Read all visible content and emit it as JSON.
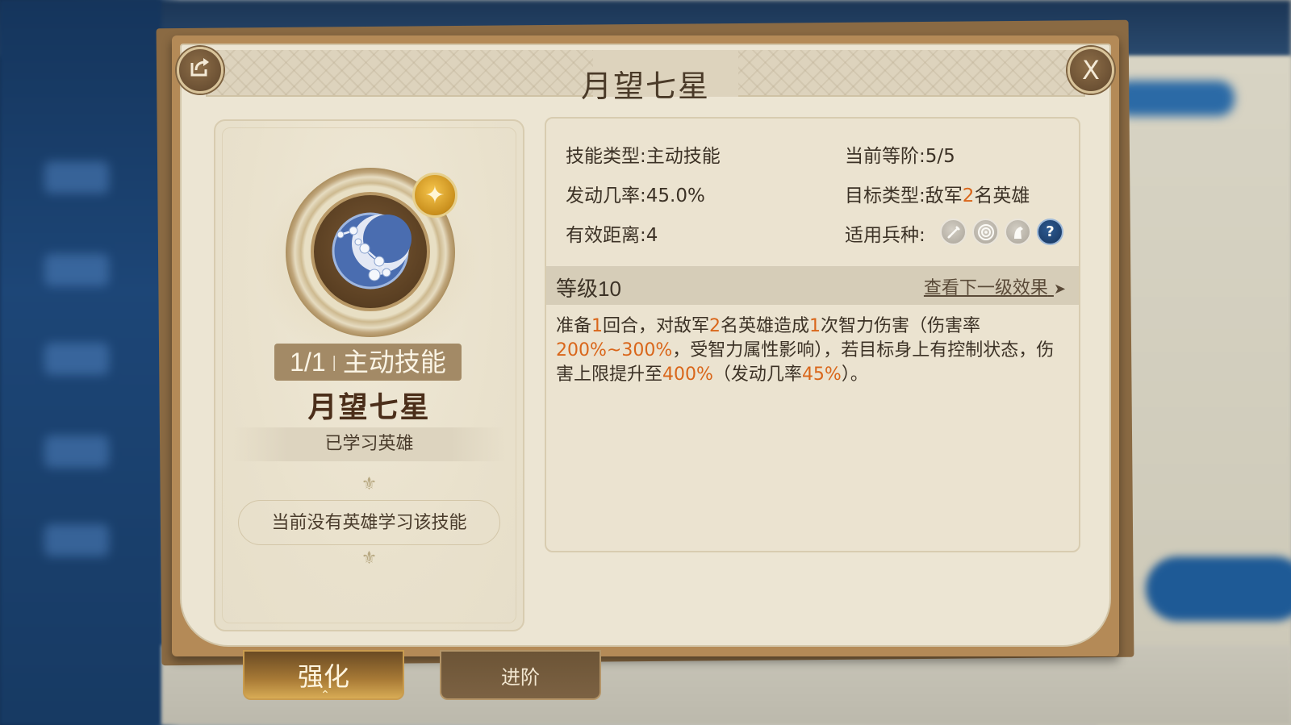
{
  "dialog": {
    "title": "月望七星",
    "share_icon": "share-icon",
    "close_label": "X"
  },
  "skill_card": {
    "icon": "constellation-moon-icon",
    "badge_icon": "gold-star-icon",
    "count": "1/1",
    "type_tag": "主动技能",
    "name": "月望七星",
    "learned_label": "已学习英雄",
    "no_hero_text": "当前没有英雄学习该技能"
  },
  "info": {
    "skill_type_label": "技能类型:",
    "skill_type_value": "主动技能",
    "rank_label": "当前等阶:",
    "rank_value": "5/5",
    "rate_label": "发动几率:",
    "rate_value": "45.0%",
    "target_label": "目标类型:",
    "target_prefix": "敌军",
    "target_count": "2",
    "target_suffix": "名英雄",
    "range_label": "有效距离:",
    "range_value": "4",
    "troop_label": "适用兵种:",
    "troop_icons": [
      "infantry-sword-icon",
      "archer-target-icon",
      "cavalry-horse-icon",
      "help-question-icon"
    ],
    "troop_help": "?"
  },
  "level": {
    "label": "等级10",
    "next_link": "查看下一级效果",
    "next_arrow": "➤"
  },
  "description": {
    "p1": "准备",
    "n1": "1",
    "p2": "回合，对敌军",
    "n2": "2",
    "p3": "名英雄造成",
    "n3": "1",
    "p4": "次智力伤害（伤害率",
    "n4": "200%~300%",
    "p5": "，受智力属性影响），若目标身上有控制状态，伤害上限提升至",
    "n5": "400%",
    "p6": "（发动几率",
    "n6": "45%",
    "p7": "）。"
  },
  "tabs": {
    "enhance": "强化",
    "advance": "进阶"
  },
  "colors": {
    "highlight": "#d9661a",
    "frame": "#b48a57",
    "paper": "#ece5d3"
  }
}
